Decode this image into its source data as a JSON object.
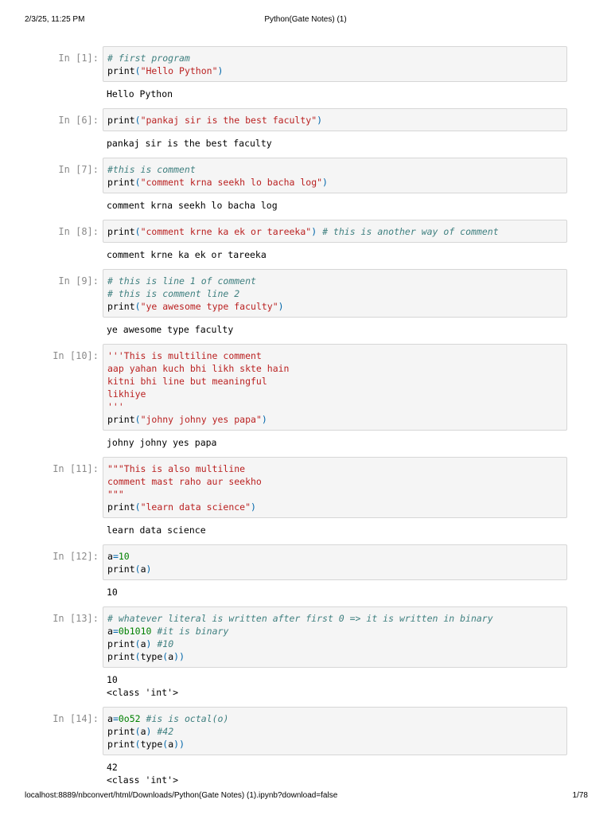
{
  "header": {
    "datetime": "2/3/25, 11:25 PM",
    "title": "Python(Gate Notes) (1)"
  },
  "footer": {
    "url": "localhost:8889/nbconvert/html/Downloads/Python(Gate Notes) (1).ipynb?download=false",
    "page": "1/78"
  },
  "colors": {
    "string": "#ba2121",
    "comment": "#408080",
    "number": "#008000",
    "builtin": "#0066aa",
    "prompt": "#8a8a8a"
  },
  "cells": [
    {
      "prompt": "In [1]:",
      "source": [
        [
          {
            "t": "cm",
            "v": "# first program"
          }
        ],
        [
          {
            "t": "fn",
            "v": "print"
          },
          {
            "t": "b",
            "v": "("
          },
          {
            "t": "str",
            "v": "\"Hello Python\""
          },
          {
            "t": "b",
            "v": ")"
          }
        ]
      ],
      "output": [
        "Hello Python"
      ]
    },
    {
      "prompt": "In [6]:",
      "source": [
        [
          {
            "t": "fn",
            "v": "print"
          },
          {
            "t": "b",
            "v": "("
          },
          {
            "t": "str",
            "v": "\"pankaj sir is the best faculty\""
          },
          {
            "t": "b",
            "v": ")"
          }
        ]
      ],
      "output": [
        "pankaj sir is the best faculty"
      ]
    },
    {
      "prompt": "In [7]:",
      "source": [
        [
          {
            "t": "cm",
            "v": "#this is comment"
          }
        ],
        [
          {
            "t": "fn",
            "v": "print"
          },
          {
            "t": "b",
            "v": "("
          },
          {
            "t": "str",
            "v": "\"comment krna seekh lo bacha log\""
          },
          {
            "t": "b",
            "v": ")"
          }
        ]
      ],
      "output": [
        "comment krna seekh lo bacha log"
      ]
    },
    {
      "prompt": "In [8]:",
      "source": [
        [
          {
            "t": "fn",
            "v": "print"
          },
          {
            "t": "b",
            "v": "("
          },
          {
            "t": "str",
            "v": "\"comment krne ka ek or tareeka\""
          },
          {
            "t": "b",
            "v": ")"
          },
          {
            "t": "p",
            "v": " "
          },
          {
            "t": "cm",
            "v": "# this is another way of comment"
          }
        ]
      ],
      "output": [
        "comment krne ka ek or tareeka"
      ]
    },
    {
      "prompt": "In [9]:",
      "source": [
        [
          {
            "t": "cm",
            "v": "# this is line 1 of comment"
          }
        ],
        [
          {
            "t": "cm",
            "v": "# this is comment line 2"
          }
        ],
        [
          {
            "t": "fn",
            "v": "print"
          },
          {
            "t": "b",
            "v": "("
          },
          {
            "t": "str",
            "v": "\"ye awesome type faculty\""
          },
          {
            "t": "b",
            "v": ")"
          }
        ]
      ],
      "output": [
        "ye awesome type faculty"
      ]
    },
    {
      "prompt": "In [10]:",
      "source": [
        [
          {
            "t": "str",
            "v": "'''This is multiline comment"
          }
        ],
        [
          {
            "t": "str",
            "v": "aap yahan kuch bhi likh skte hain"
          }
        ],
        [
          {
            "t": "str",
            "v": "kitni bhi line but meaningful"
          }
        ],
        [
          {
            "t": "str",
            "v": "likhiye"
          }
        ],
        [
          {
            "t": "str",
            "v": "'''"
          }
        ],
        [
          {
            "t": "fn",
            "v": "print"
          },
          {
            "t": "b",
            "v": "("
          },
          {
            "t": "str",
            "v": "\"johny johny yes papa\""
          },
          {
            "t": "b",
            "v": ")"
          }
        ]
      ],
      "output": [
        "johny johny yes papa"
      ]
    },
    {
      "prompt": "In [11]:",
      "source": [
        [
          {
            "t": "str",
            "v": "\"\"\"This is also multiline"
          }
        ],
        [
          {
            "t": "str",
            "v": "comment mast raho aur seekho"
          }
        ],
        [
          {
            "t": "str",
            "v": "\"\"\""
          }
        ],
        [
          {
            "t": "fn",
            "v": "print"
          },
          {
            "t": "b",
            "v": "("
          },
          {
            "t": "str",
            "v": "\"learn data science\""
          },
          {
            "t": "b",
            "v": ")"
          }
        ]
      ],
      "output": [
        "learn data science"
      ]
    },
    {
      "prompt": "In [12]:",
      "source": [
        [
          {
            "t": "p",
            "v": "a"
          },
          {
            "t": "b",
            "v": "="
          },
          {
            "t": "num",
            "v": "10"
          }
        ],
        [
          {
            "t": "fn",
            "v": "print"
          },
          {
            "t": "b",
            "v": "("
          },
          {
            "t": "p",
            "v": "a"
          },
          {
            "t": "b",
            "v": ")"
          }
        ]
      ],
      "output": [
        "10"
      ]
    },
    {
      "prompt": "In [13]:",
      "source": [
        [
          {
            "t": "cm",
            "v": "# whatever literal is written after first 0 => it is written in binary"
          }
        ],
        [
          {
            "t": "p",
            "v": "a"
          },
          {
            "t": "b",
            "v": "="
          },
          {
            "t": "num",
            "v": "0b1010"
          },
          {
            "t": "p",
            "v": " "
          },
          {
            "t": "cm",
            "v": "#it is binary"
          }
        ],
        [
          {
            "t": "fn",
            "v": "print"
          },
          {
            "t": "b",
            "v": "("
          },
          {
            "t": "p",
            "v": "a"
          },
          {
            "t": "b",
            "v": ")"
          },
          {
            "t": "p",
            "v": " "
          },
          {
            "t": "cm",
            "v": "#10"
          }
        ],
        [
          {
            "t": "fn",
            "v": "print"
          },
          {
            "t": "b",
            "v": "("
          },
          {
            "t": "fn",
            "v": "type"
          },
          {
            "t": "b",
            "v": "("
          },
          {
            "t": "p",
            "v": "a"
          },
          {
            "t": "b",
            "v": "))"
          }
        ]
      ],
      "output": [
        "10",
        "<class 'int'>"
      ]
    },
    {
      "prompt": "In [14]:",
      "source": [
        [
          {
            "t": "p",
            "v": "a"
          },
          {
            "t": "b",
            "v": "="
          },
          {
            "t": "num",
            "v": "0o52"
          },
          {
            "t": "p",
            "v": " "
          },
          {
            "t": "cm",
            "v": "#is is octal(o)"
          }
        ],
        [
          {
            "t": "fn",
            "v": "print"
          },
          {
            "t": "b",
            "v": "("
          },
          {
            "t": "p",
            "v": "a"
          },
          {
            "t": "b",
            "v": ")"
          },
          {
            "t": "p",
            "v": " "
          },
          {
            "t": "cm",
            "v": "#42"
          }
        ],
        [
          {
            "t": "fn",
            "v": "print"
          },
          {
            "t": "b",
            "v": "("
          },
          {
            "t": "fn",
            "v": "type"
          },
          {
            "t": "b",
            "v": "("
          },
          {
            "t": "p",
            "v": "a"
          },
          {
            "t": "b",
            "v": "))"
          }
        ]
      ],
      "output": [
        "42",
        "<class 'int'>"
      ]
    }
  ]
}
